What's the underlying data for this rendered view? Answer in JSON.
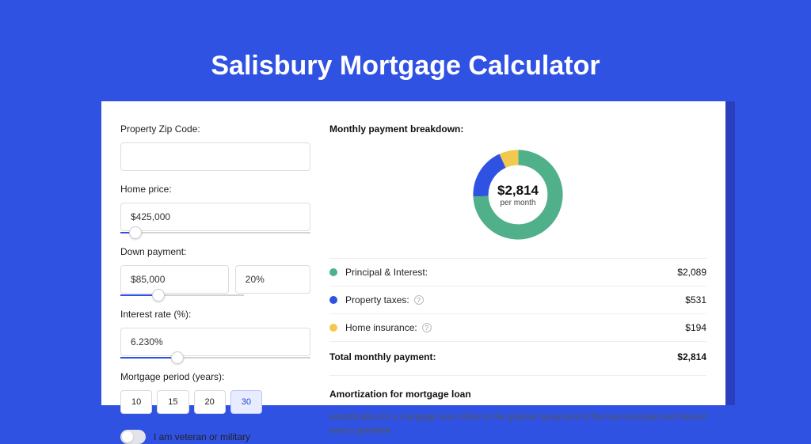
{
  "title": "Salisbury Mortgage Calculator",
  "form": {
    "zip": {
      "label": "Property Zip Code:",
      "value": ""
    },
    "homePrice": {
      "label": "Home price:",
      "value": "$425,000",
      "sliderPct": 8
    },
    "downPayment": {
      "label": "Down payment:",
      "amount": "$85,000",
      "pct": "20%",
      "sliderPct": 20
    },
    "interest": {
      "label": "Interest rate (%):",
      "value": "6.230%",
      "sliderPct": 30
    },
    "period": {
      "label": "Mortgage period (years):",
      "options": [
        "10",
        "15",
        "20",
        "30"
      ],
      "active": "30"
    },
    "veteran": {
      "label": "I am veteran or military",
      "value": false
    }
  },
  "breakdown": {
    "title": "Monthly payment breakdown:",
    "centerAmount": "$2,814",
    "centerSub": "per month",
    "items": [
      {
        "label": "Principal & Interest:",
        "value": "$2,089",
        "color": "#4fb08a",
        "help": false
      },
      {
        "label": "Property taxes:",
        "value": "$531",
        "color": "#3052e3",
        "help": true
      },
      {
        "label": "Home insurance:",
        "value": "$194",
        "color": "#f1c94e",
        "help": true
      }
    ],
    "totalLabel": "Total monthly payment:",
    "totalValue": "$2,814"
  },
  "chart_data": {
    "type": "pie",
    "title": "Monthly payment breakdown",
    "series": [
      {
        "name": "Principal & Interest",
        "value": 2089,
        "color": "#4fb08a"
      },
      {
        "name": "Property taxes",
        "value": 531,
        "color": "#3052e3"
      },
      {
        "name": "Home insurance",
        "value": 194,
        "color": "#f1c94e"
      }
    ],
    "total": 2814,
    "center_label": "$2,814 per month"
  },
  "amortization": {
    "title": "Amortization for mortgage loan",
    "text": "Amortization for a mortgage loan refers to the gradual repayment of the loan principal and interest over a specified"
  }
}
